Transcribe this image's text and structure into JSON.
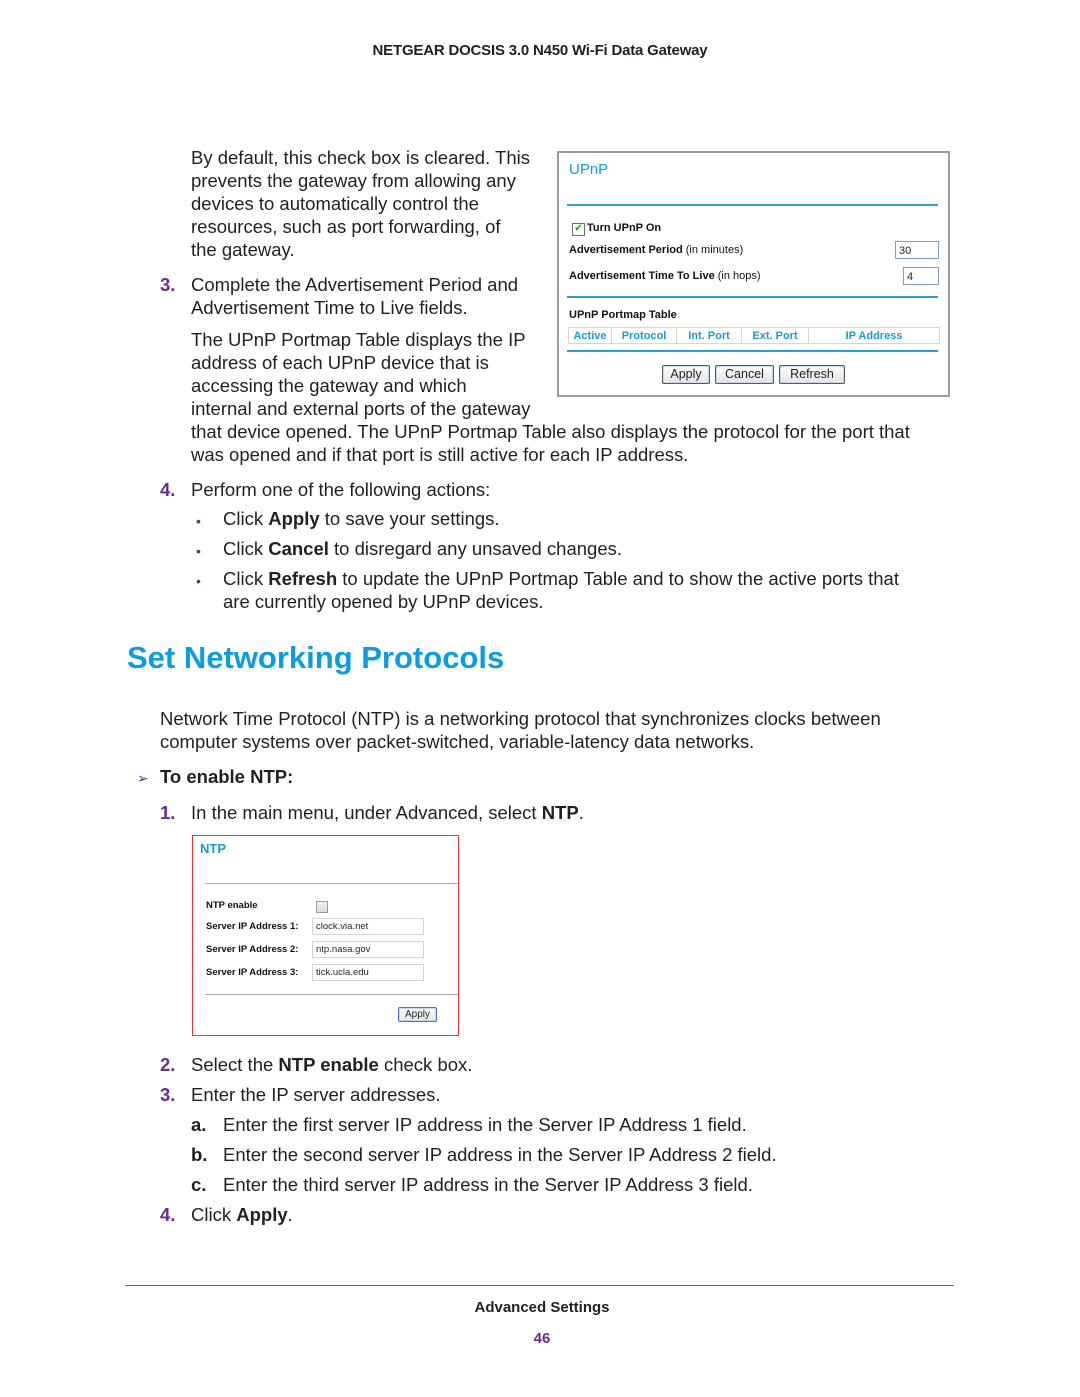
{
  "header": {
    "title": "NETGEAR DOCSIS 3.0 N450 Wi-Fi Data Gateway"
  },
  "intro": {
    "lines": [
      "By default, this check box is cleared. This",
      "prevents the gateway from allowing any",
      "devices to automatically control the",
      "resources, such as port forwarding, of",
      "the gateway."
    ]
  },
  "step3": {
    "number": "3.",
    "lines": [
      "Complete the Advertisement Period and",
      "Advertisement Time to Live fields."
    ],
    "para_lines": [
      "The UPnP Portmap Table displays the IP",
      "address of each UPnP device that is",
      "accessing the gateway and which",
      "internal and external ports of the gateway",
      "that device opened. The UPnP Portmap Table also displays the protocol for the port that",
      "was opened and if that port is still active for each IP address."
    ]
  },
  "upnp_panel": {
    "title": "UPnP",
    "turn_on_label": "Turn UPnP On",
    "turn_on_checked": true,
    "check_glyph": "✔",
    "adv_period_label": "Advertisement Period",
    "adv_period_unit": "(in minutes)",
    "adv_period_value": "30",
    "adv_ttl_label": "Advertisement Time To Live",
    "adv_ttl_unit": "(in hops)",
    "adv_ttl_value": "4",
    "portmap_title": "UPnP Portmap Table",
    "columns": [
      "Active",
      "Protocol",
      "Int. Port",
      "Ext. Port",
      "IP Address"
    ],
    "buttons": {
      "apply": "Apply",
      "cancel": "Cancel",
      "refresh": "Refresh"
    }
  },
  "step4": {
    "number": "4.",
    "text": "Perform one of the following actions:",
    "bullet_glyph": "•",
    "bullets": [
      {
        "pre": "Click ",
        "bold": "Apply",
        "post": " to save your settings."
      },
      {
        "pre": "Click ",
        "bold": "Cancel",
        "post": " to disregard any unsaved changes."
      },
      {
        "pre": "Click ",
        "bold": "Refresh",
        "post": " to update the UPnP Portmap Table and to show the active ports that",
        "cont": "are currently opened by UPnP devices."
      }
    ]
  },
  "section": {
    "title": "Set Networking Protocols",
    "para_lines": [
      "Network Time Protocol (NTP) is a networking protocol that synchronizes clocks between",
      "computer systems over packet-switched, variable-latency data networks."
    ],
    "procedure_glyph": "➢",
    "procedure_title": "To enable NTP:",
    "steps": [
      {
        "number": "1.",
        "pre": "In the main menu, under Advanced, select ",
        "bold": "NTP",
        "post": "."
      },
      {
        "number": "2.",
        "pre": "Select the ",
        "bold": "NTP enable",
        "post": " check box."
      },
      {
        "number": "3.",
        "pre": "Enter the IP server addresses.",
        "bold": "",
        "post": ""
      },
      {
        "number": "4.",
        "pre": "Click ",
        "bold": "Apply",
        "post": "."
      }
    ],
    "substeps": [
      {
        "letter": "a.",
        "text": "Enter the first server IP address in the Server IP Address 1 field."
      },
      {
        "letter": "b.",
        "text": "Enter the second server IP address in the Server IP Address 2 field."
      },
      {
        "letter": "c.",
        "text": "Enter the third server IP address in the Server IP Address 3 field."
      }
    ]
  },
  "ntp_panel": {
    "title": "NTP",
    "enable_label": "NTP enable",
    "enable_checked": false,
    "servers": [
      {
        "label": "Server IP Address 1:",
        "value": "clock.via.net"
      },
      {
        "label": "Server IP Address 2:",
        "value": "ntp.nasa.gov"
      },
      {
        "label": "Server IP Address 3:",
        "value": "tick.ucla.edu"
      }
    ],
    "apply_label": "Apply"
  },
  "footer": {
    "section": "Advanced Settings",
    "page": "46"
  },
  "colors": {
    "accent_purple": "#6b2c91",
    "heading_blue": "#0a9ee0",
    "panel_blue": "#1a9ad6",
    "ntp_border_red": "#e8333a"
  }
}
